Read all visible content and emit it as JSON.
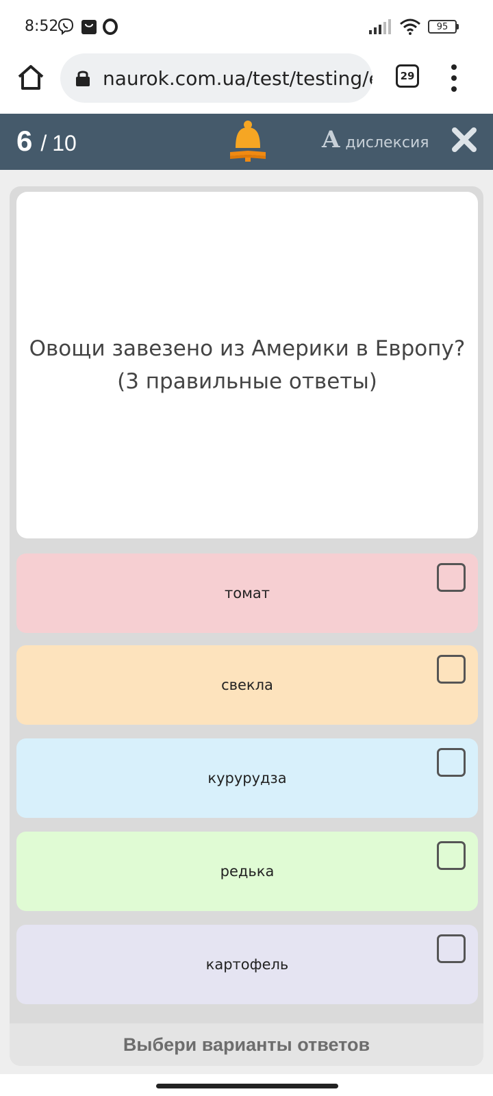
{
  "status_bar": {
    "time": "8:52",
    "icons": [
      "viber-icon",
      "shopping-bag-icon",
      "opera-icon",
      "signal-icon",
      "wifi-icon"
    ],
    "battery": "95"
  },
  "browser": {
    "url": "naurok.com.ua/test/testing/e",
    "tab_count": "29"
  },
  "header": {
    "current": "6",
    "separator": "/",
    "total": "10",
    "dyslexia_letter": "A",
    "dyslexia_label": "дислексия",
    "bell_color": "#f6a623"
  },
  "question": {
    "text": "Овощи завезено из Америки в Европу? (3 правильные ответы)"
  },
  "options": [
    {
      "label": "томат",
      "color": "#f6cfd2"
    },
    {
      "label": "свекла",
      "color": "#fde3bd"
    },
    {
      "label": "курурудза",
      "color": "#d8f0fb"
    },
    {
      "label": "редька",
      "color": "#e0fbd4"
    },
    {
      "label": "картофель",
      "color": "#e5e4f2"
    }
  ],
  "footer": {
    "instruction": "Выбери варианты ответов"
  },
  "colors": {
    "header_bg": "#455a6b"
  }
}
